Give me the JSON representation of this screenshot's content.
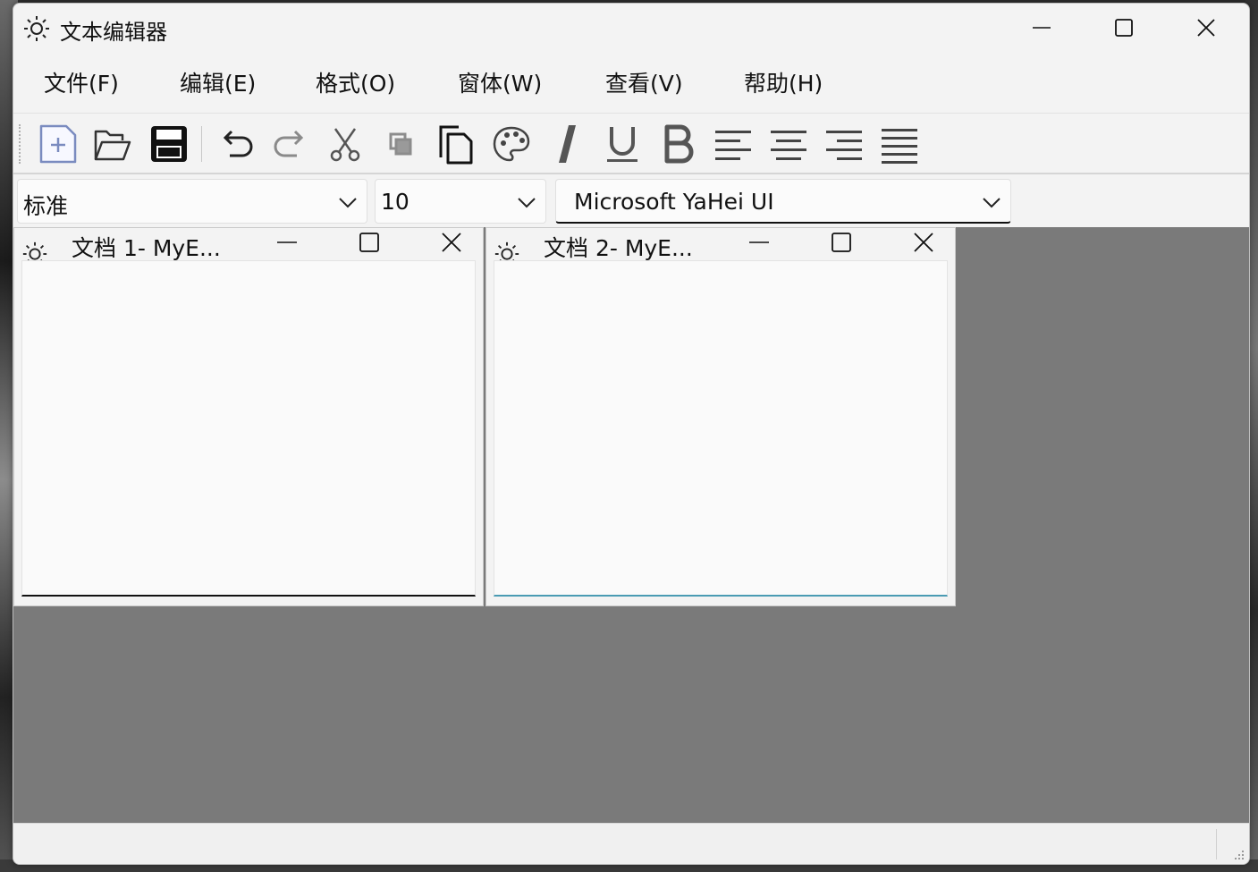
{
  "window": {
    "title": "文本编辑器"
  },
  "caption": {
    "minimize": "minimize-icon",
    "maximize": "maximize-icon",
    "close": "close-icon"
  },
  "menu": [
    {
      "label": "文件(F)"
    },
    {
      "label": "编辑(E)"
    },
    {
      "label": "格式(O)"
    },
    {
      "label": "窗体(W)"
    },
    {
      "label": "查看(V)"
    },
    {
      "label": "帮助(H)"
    }
  ],
  "toolbar": {
    "icons": [
      "new-icon",
      "open-icon",
      "save-icon",
      "undo-icon",
      "redo-icon",
      "cut-icon",
      "copy-icon",
      "paste-icon",
      "color-palette-icon",
      "italic-icon",
      "underline-icon",
      "bold-icon",
      "align-left-icon",
      "align-center-icon",
      "align-right-icon",
      "justify-icon"
    ]
  },
  "format": {
    "style": "标准",
    "size": "10",
    "font": "Microsoft YaHei UI"
  },
  "children": [
    {
      "title": "文档 1- MyE...",
      "text": ""
    },
    {
      "title": "文档 2- MyE...",
      "text": ""
    }
  ],
  "colors": {
    "mdi_background": "#7a7a7a",
    "focus_accent": "#4a9bb3"
  }
}
